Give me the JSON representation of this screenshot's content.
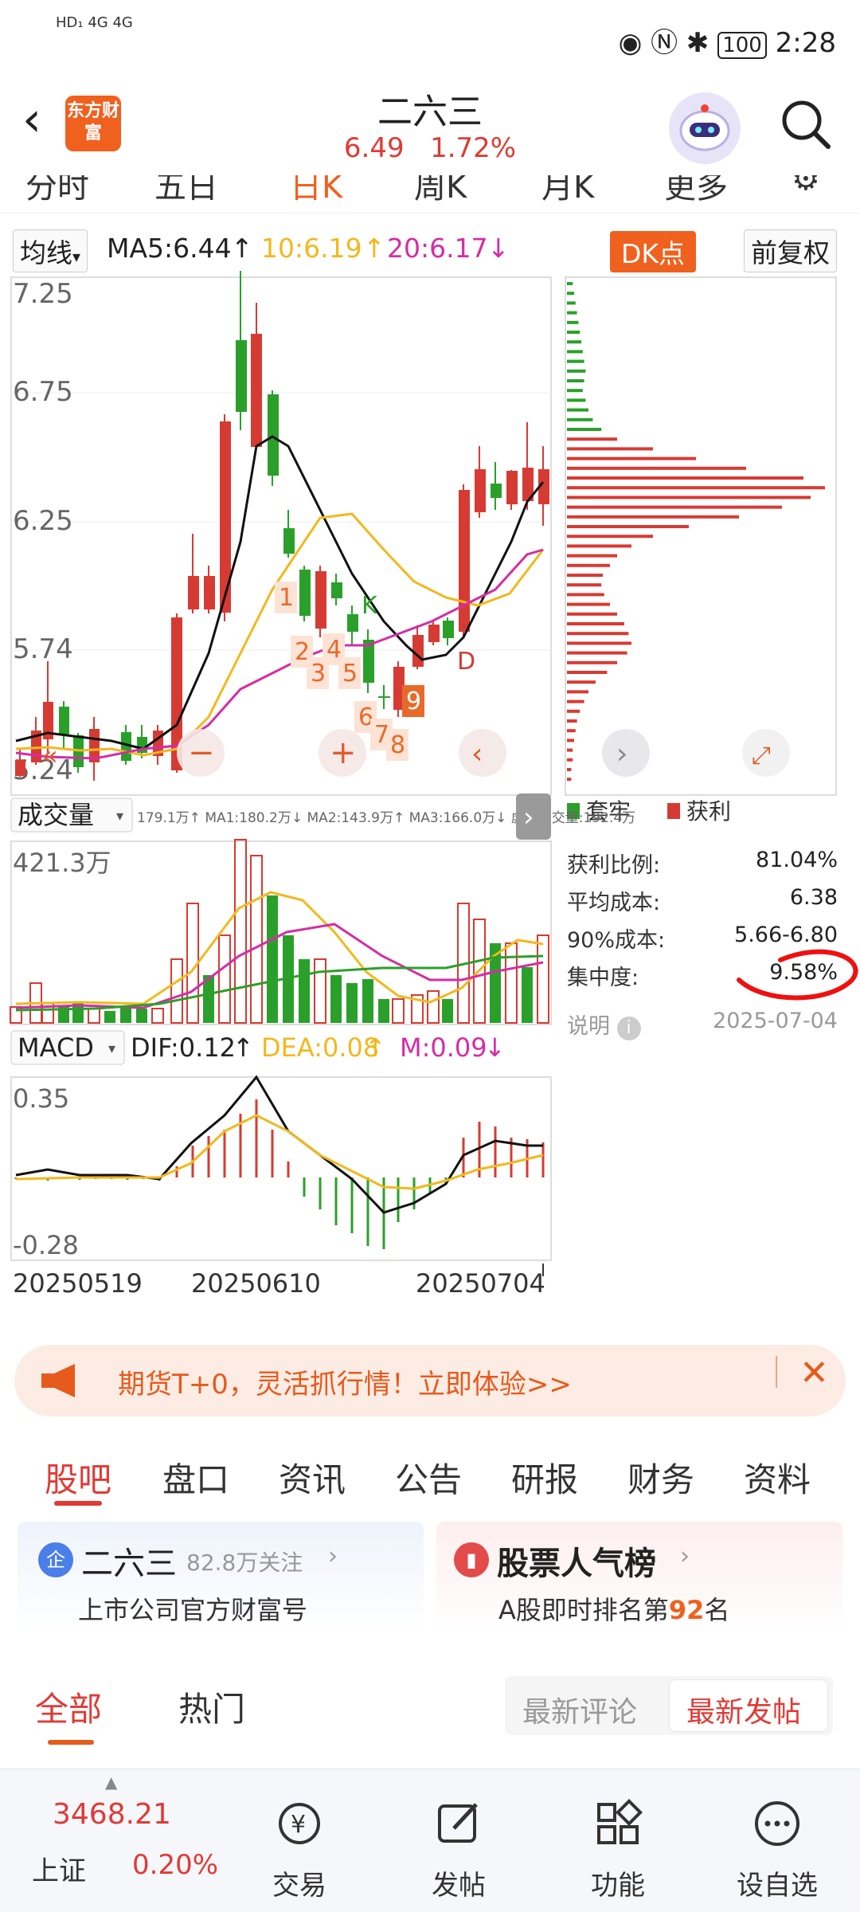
{
  "status": {
    "left_text": "HD₁ 4G 4G",
    "battery": "100",
    "time": "2:28"
  },
  "header": {
    "logo": "东方财富",
    "title": "二六三",
    "price": "6.49",
    "change_pct": "1.72%"
  },
  "tabs": [
    "分时",
    "五日",
    "日K",
    "周K",
    "月K",
    "更多"
  ],
  "active_tab": "日K",
  "ma_bar": {
    "label": "均线",
    "ma5": "MA5:6.44",
    "ma10": "10:6.19",
    "ma20": "20:6.17",
    "dk": "DK点",
    "adjust": "前复权"
  },
  "kline": {
    "y_top": "7.25",
    "y_labels": [
      "7.25",
      "6.75",
      "6.25",
      "5.74"
    ],
    "y_bottom": "5.24",
    "markers": [
      "1",
      "2",
      "3",
      "4",
      "5",
      "6",
      "7",
      "8",
      "9",
      "K",
      "D"
    ]
  },
  "volume_bar": {
    "label": "成交量",
    "info": "179.1万↑ MA1:180.2万↓ MA2:143.9万↑ MA3:166.0万↓ 虚拟成交量:192.4万",
    "y_top": "421.3万"
  },
  "macd_bar": {
    "label": "MACD",
    "dif": "DIF:0.12",
    "dea": "DEA:0.08",
    "m": "M:0.09",
    "y_top": "0.35",
    "y_bottom": "-0.28"
  },
  "dates": [
    "20250519",
    "20250610",
    "20250704"
  ],
  "chip": {
    "legend_trapped": "套牢",
    "legend_profit": "获利",
    "rows": [
      {
        "label": "获利比例:",
        "value": "81.04%"
      },
      {
        "label": "平均成本:",
        "value": "6.38"
      },
      {
        "label": "90%成本:",
        "value": "5.66-6.80"
      },
      {
        "label": "集中度:",
        "value": "9.58%"
      }
    ],
    "note_label": "说明",
    "note_date": "2025-07-04"
  },
  "banner": {
    "text": "期货T+0，灵活抓行情！立即体验>>"
  },
  "section_tabs": [
    "股吧",
    "盘口",
    "资讯",
    "公告",
    "研报",
    "财务",
    "资料"
  ],
  "cards": {
    "company_badge": "企",
    "company_name": "二六三",
    "followers": "82.8万关注",
    "company_sub": "上市公司官方财富号",
    "rank_title": "股票人气榜",
    "rank_sub_prefix": "A股即时排名第",
    "rank_num": "92",
    "rank_sub_suffix": "名"
  },
  "feed": {
    "all": "全部",
    "hot": "热门",
    "latest_comment": "最新评论",
    "latest_post": "最新发帖"
  },
  "bottom": {
    "index_value": "3468.21",
    "index_name": "上证",
    "index_change": "0.20%",
    "trade": "交易",
    "post": "发帖",
    "func": "功能",
    "watch": "设自选"
  },
  "colors": {
    "up": "#e03a35",
    "down": "#2aa02a",
    "accent": "#f0601e",
    "ma10": "#f2b81d",
    "ma20": "#d62ca6"
  }
}
